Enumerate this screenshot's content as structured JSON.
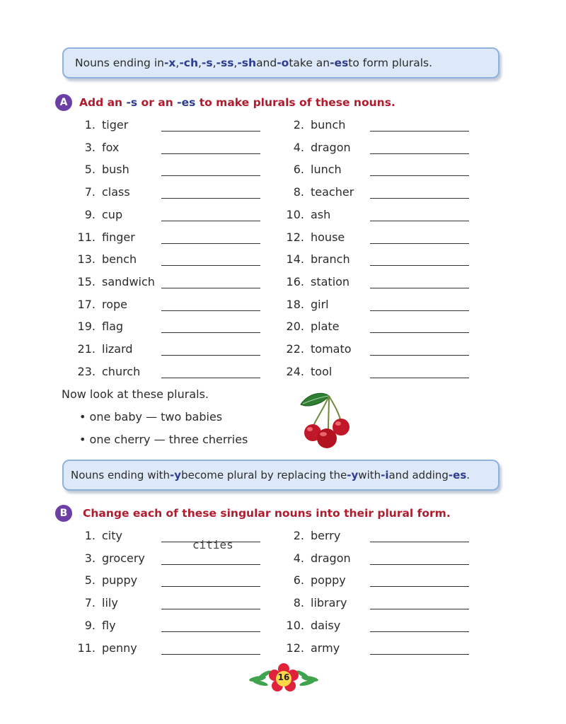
{
  "rule1": {
    "parts": [
      {
        "t": "Nouns ending in ",
        "hl": false
      },
      {
        "t": "-x",
        "hl": true
      },
      {
        "t": ", ",
        "hl": false
      },
      {
        "t": "-ch",
        "hl": true
      },
      {
        "t": ", ",
        "hl": false
      },
      {
        "t": "-s",
        "hl": true
      },
      {
        "t": ", ",
        "hl": false
      },
      {
        "t": "-ss",
        "hl": true
      },
      {
        "t": ", ",
        "hl": false
      },
      {
        "t": "-sh",
        "hl": true
      },
      {
        "t": " and ",
        "hl": false
      },
      {
        "t": "-o",
        "hl": true
      },
      {
        "t": " take an ",
        "hl": false
      },
      {
        "t": "-es",
        "hl": true
      },
      {
        "t": " to form plurals.",
        "hl": false
      }
    ]
  },
  "sectionA": {
    "badge": "A",
    "heading_parts": [
      {
        "t": "Add an ",
        "blue": false
      },
      {
        "t": "-s",
        "blue": true
      },
      {
        "t": " or an ",
        "blue": false
      },
      {
        "t": "-es",
        "blue": true
      },
      {
        "t": " to make plurals of these nouns.",
        "blue": false
      }
    ],
    "items": [
      {
        "n": "1.",
        "w": "tiger"
      },
      {
        "n": "2.",
        "w": "bunch"
      },
      {
        "n": "3.",
        "w": "fox"
      },
      {
        "n": "4.",
        "w": "dragon"
      },
      {
        "n": "5.",
        "w": "bush"
      },
      {
        "n": "6.",
        "w": "lunch"
      },
      {
        "n": "7.",
        "w": "class"
      },
      {
        "n": "8.",
        "w": "teacher"
      },
      {
        "n": "9.",
        "w": "cup"
      },
      {
        "n": "10.",
        "w": "ash"
      },
      {
        "n": "11.",
        "w": "finger"
      },
      {
        "n": "12.",
        "w": "house"
      },
      {
        "n": "13.",
        "w": "bench"
      },
      {
        "n": "14.",
        "w": "branch"
      },
      {
        "n": "15.",
        "w": "sandwich"
      },
      {
        "n": "16.",
        "w": "station"
      },
      {
        "n": "17.",
        "w": "rope"
      },
      {
        "n": "18.",
        "w": "girl"
      },
      {
        "n": "19.",
        "w": "flag"
      },
      {
        "n": "20.",
        "w": "plate"
      },
      {
        "n": "21.",
        "w": "lizard"
      },
      {
        "n": "22.",
        "w": "tomato"
      },
      {
        "n": "23.",
        "w": "church"
      },
      {
        "n": "24.",
        "w": "tool"
      }
    ]
  },
  "examples": {
    "intro": "Now look at these plurals.",
    "bullets": [
      "one baby — two babies",
      "one cherry — three cherries"
    ]
  },
  "rule2": {
    "parts": [
      {
        "t": "Nouns ending with ",
        "hl": false
      },
      {
        "t": "-y",
        "hl": true
      },
      {
        "t": " become plural by replacing the ",
        "hl": false
      },
      {
        "t": "-y",
        "hl": true
      },
      {
        "t": " with ",
        "hl": false
      },
      {
        "t": "-i",
        "hl": true
      },
      {
        "t": " and adding ",
        "hl": false
      },
      {
        "t": "-es",
        "hl": true
      },
      {
        "t": ".",
        "hl": false
      }
    ]
  },
  "sectionB": {
    "badge": "B",
    "heading": "Change each of these singular nouns into their plural form.",
    "items": [
      {
        "n": "1.",
        "w": "city",
        "answer": "cities"
      },
      {
        "n": "2.",
        "w": "berry"
      },
      {
        "n": "3.",
        "w": "grocery"
      },
      {
        "n": "4.",
        "w": "dragon"
      },
      {
        "n": "5.",
        "w": "puppy"
      },
      {
        "n": "6.",
        "w": "poppy"
      },
      {
        "n": "7.",
        "w": "lily"
      },
      {
        "n": "8.",
        "w": "library"
      },
      {
        "n": "9.",
        "w": "fly"
      },
      {
        "n": "10.",
        "w": "daisy"
      },
      {
        "n": "11.",
        "w": "penny"
      },
      {
        "n": "12.",
        "w": "army"
      }
    ]
  },
  "footer": {
    "page_number": "16"
  },
  "colors": {
    "accent_red": "#b01c2e",
    "accent_blue": "#2e3c8f",
    "badge_purple": "#6c3fa6",
    "box_fill": "#dde9f8"
  }
}
